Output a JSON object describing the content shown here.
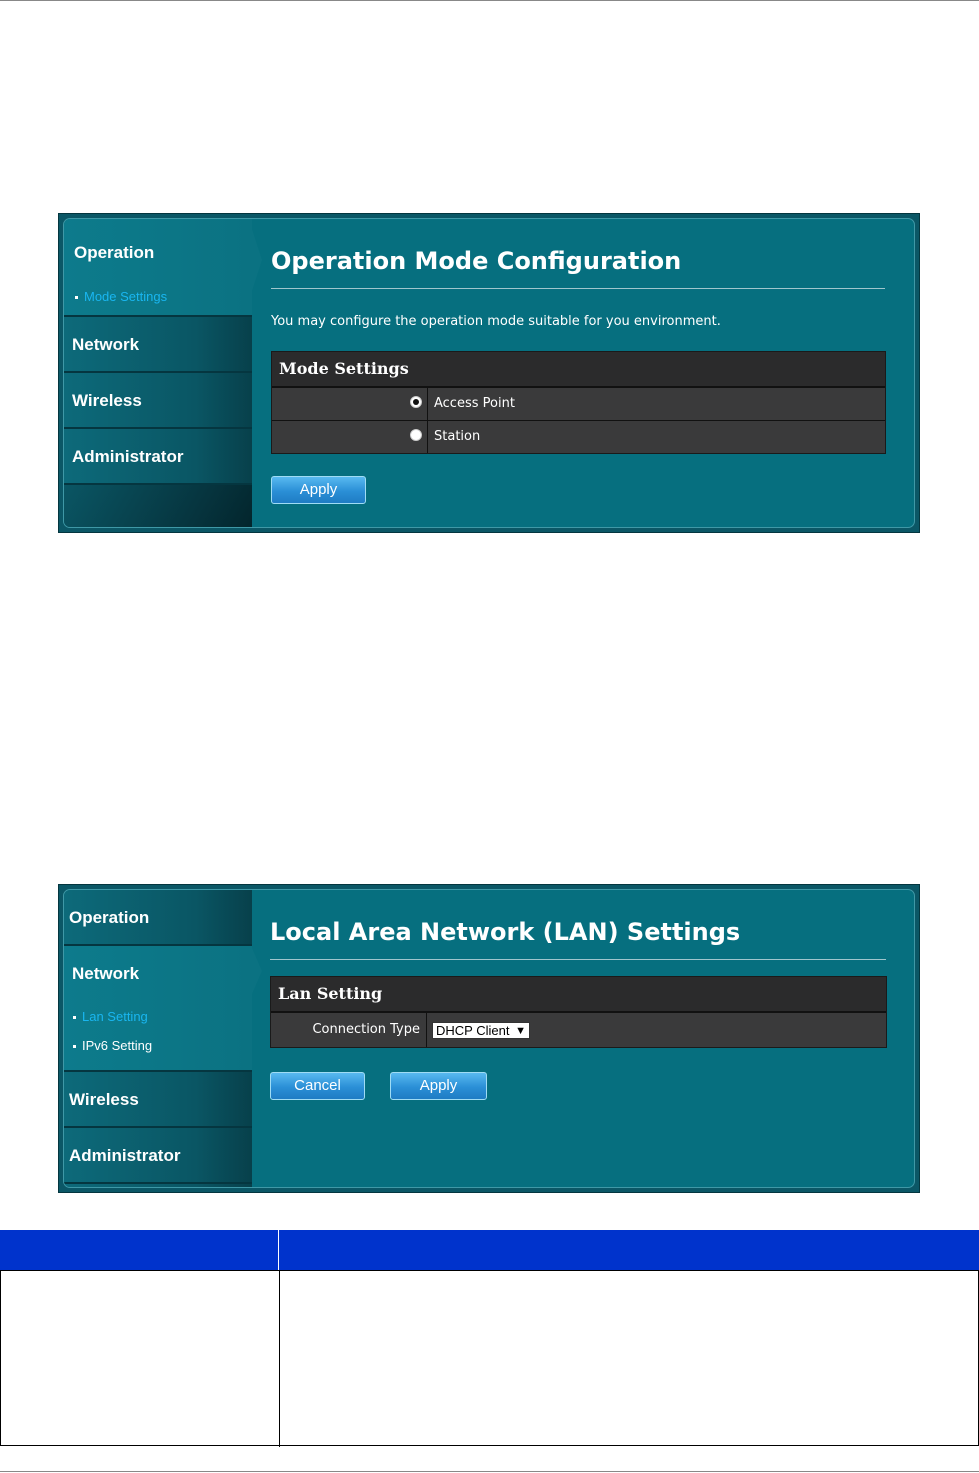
{
  "screen1": {
    "sidebar": [
      {
        "label": "Operation",
        "subitems": [
          {
            "label": "Mode Settings",
            "current": true
          }
        ]
      },
      {
        "label": "Network"
      },
      {
        "label": "Wireless"
      },
      {
        "label": "Administrator"
      }
    ],
    "title": "Operation Mode Configuration",
    "description": "You may configure the operation mode suitable for you environment.",
    "section_header": "Mode Settings",
    "options": [
      {
        "label": "Access Point",
        "selected": true
      },
      {
        "label": "Station",
        "selected": false
      }
    ],
    "apply_label": "Apply"
  },
  "screen2": {
    "sidebar": [
      {
        "label": "Operation"
      },
      {
        "label": "Network",
        "subitems": [
          {
            "label": "Lan Setting",
            "current": true
          },
          {
            "label": "IPv6 Setting",
            "current": false
          }
        ]
      },
      {
        "label": "Wireless"
      },
      {
        "label": "Administrator"
      }
    ],
    "title": "Local Area Network (LAN) Settings",
    "section_header": "Lan Setting",
    "field_label": "Connection Type",
    "field_value": "DHCP Client",
    "cancel_label": "Cancel",
    "apply_label": "Apply"
  },
  "colors": {
    "panel_bg": "#066f7f",
    "sub_link": "#19b6f0",
    "button": "#2a8fd6",
    "table_header": "#0033cc"
  },
  "icons": {
    "radio": "radio-icon",
    "dropdown": "chevron-down-icon"
  }
}
